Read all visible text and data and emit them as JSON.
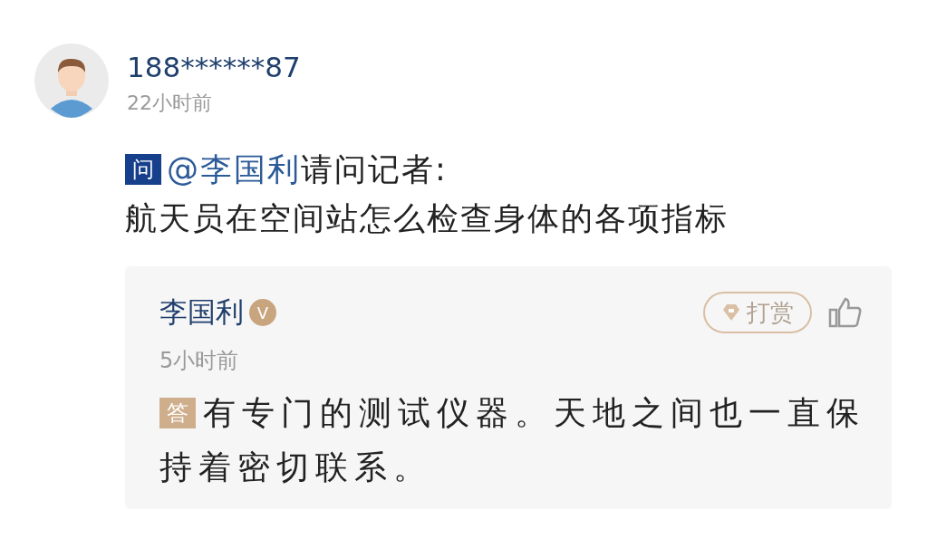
{
  "question": {
    "author": "188******87",
    "time": "22小时前",
    "badge": "问",
    "mention": "@李国利",
    "text": "请问记者:\n航天员在空间站怎么检查身体的各项指标"
  },
  "answer": {
    "author": "李国利",
    "verified": true,
    "verified_badge": "V",
    "tip_label": "打赏",
    "time": "5小时前",
    "badge": "答",
    "text": "有专门的测试仪器。天地之间也一直保持着密切联系。"
  }
}
